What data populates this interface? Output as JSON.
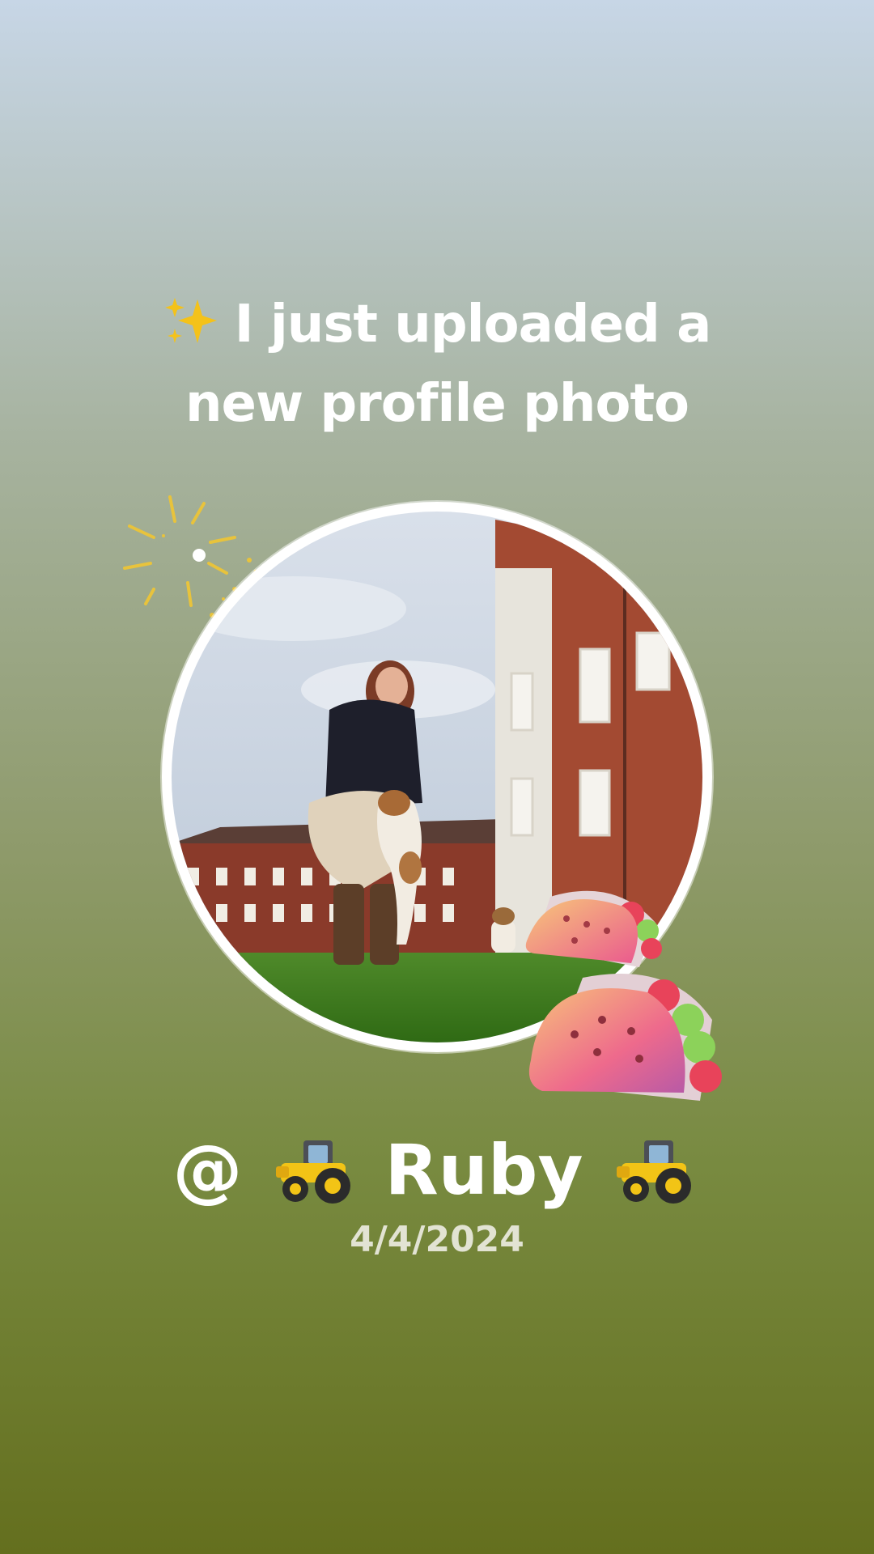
{
  "headline": {
    "line1": "I just uploaded a",
    "line2": "new profile photo",
    "icon": "sparkles-icon"
  },
  "profile_photo": {
    "description_icon": "profile-photo",
    "decorations": [
      "burst-icon",
      "taco-icon",
      "taco-icon"
    ]
  },
  "username": {
    "prefix": "@",
    "name": "Ruby",
    "icon": "tractor-icon"
  },
  "date": "4/4/2024",
  "colors": {
    "background_top": "#c7d6e6",
    "background_bottom": "#646f1e",
    "text": "#ffffff",
    "date_text": "#e2e3d3"
  }
}
